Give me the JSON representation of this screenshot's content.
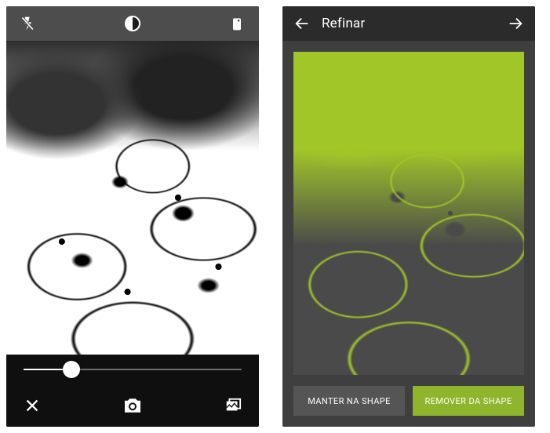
{
  "left": {
    "topbar": {
      "flash_icon": "flash-off",
      "mode_icon": "bw-circle",
      "switch_icon": "switch-camera"
    },
    "slider": {
      "percent": 22
    },
    "bottombar": {
      "close_icon": "close",
      "shutter_icon": "camera",
      "gallery_icon": "gallery"
    }
  },
  "right": {
    "header": {
      "back_icon": "arrow-back",
      "title": "Refinar",
      "forward_icon": "arrow-forward"
    },
    "buttons": {
      "keep_label": "MANTER NA SHAPE",
      "remove_label": "REMOVER DA SHAPE"
    },
    "accent": "#8eb52b"
  }
}
